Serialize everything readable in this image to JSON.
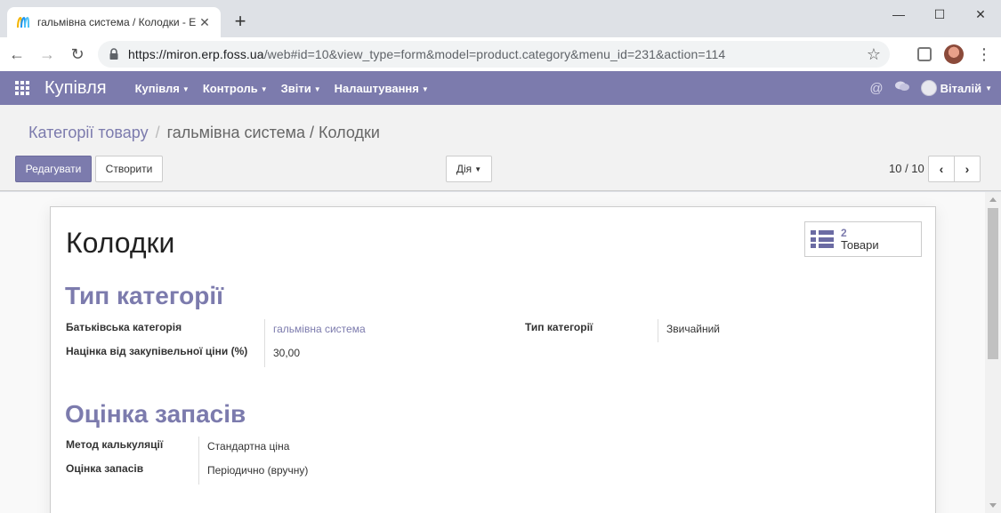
{
  "browser": {
    "tab_title": "гальмівна система / Колодки - Е",
    "url_host": "https://miron.erp.foss.ua",
    "url_rest": "/web#id=10&view_type=form&model=product.category&menu_id=231&action=114"
  },
  "navbar": {
    "app_name": "Купівля",
    "menu": [
      "Купівля",
      "Контроль",
      "Звіти",
      "Налаштування"
    ],
    "user_name": "Віталій"
  },
  "breadcrumb": {
    "parent": "Категорії товару",
    "current": "гальмівна система / Колодки"
  },
  "buttons": {
    "edit": "Редагувати",
    "create": "Створити",
    "action": "Дія"
  },
  "pager": {
    "value": "10 / 10"
  },
  "record": {
    "title": "Колодки",
    "smart_button": {
      "count": "2",
      "label": "Товари"
    }
  },
  "sections": {
    "category_type": {
      "title": "Тип категорії",
      "parent_label": "Батьківська категорія",
      "parent_value": "гальмівна система",
      "markup_label": "Націнка від закупівельної ціни (%)",
      "markup_value": "30,00",
      "type_label": "Тип категорії",
      "type_value": "Звичайний"
    },
    "inventory_valuation": {
      "title": "Оцінка запасів",
      "costing_label": "Метод калькуляції",
      "costing_value": "Стандартна ціна",
      "valuation_label": "Оцінка запасів",
      "valuation_value": "Періодично (вручну)"
    }
  },
  "colors": {
    "brand": "#7c7bad"
  },
  "icons": [
    "apps-grid-icon",
    "at-sign-icon",
    "chat-icon",
    "list-icon",
    "lock-icon",
    "star-icon"
  ]
}
